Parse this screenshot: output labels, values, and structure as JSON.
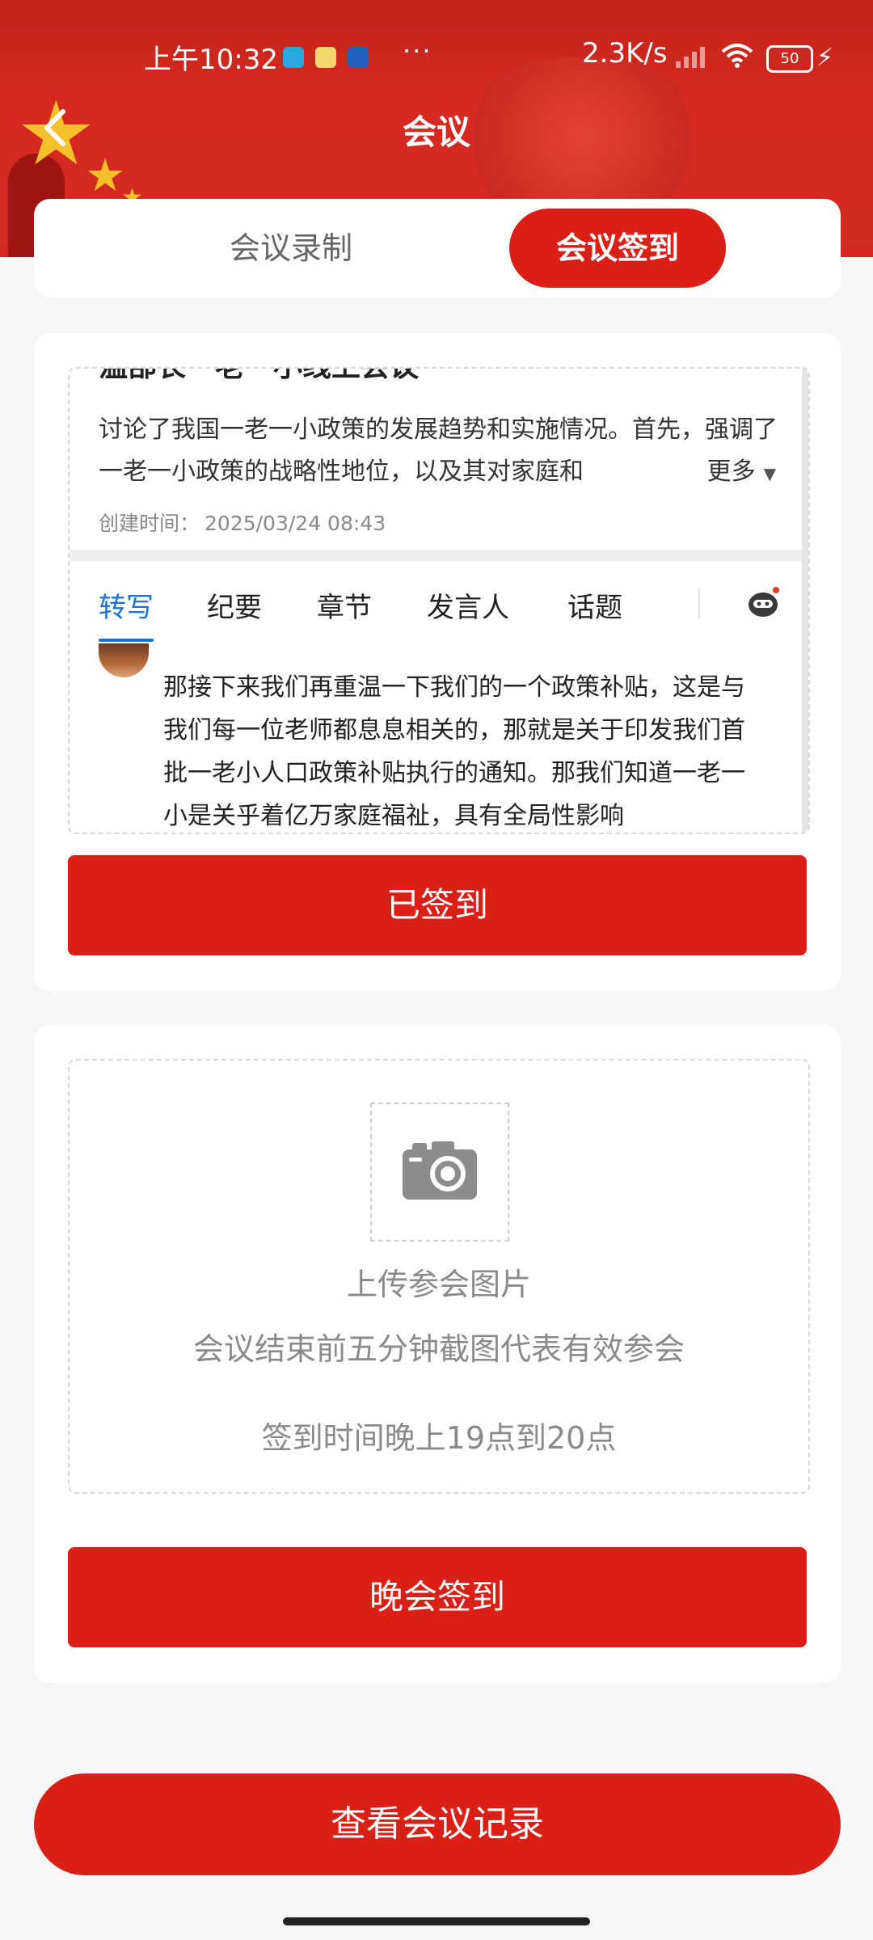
{
  "status_bar": {
    "time": "上午10:32",
    "more_dots": "···",
    "net_speed": "2.3K/s",
    "battery": "50",
    "charging_icon": "bolt-icon"
  },
  "header": {
    "title": "会议",
    "back_icon": "chevron-left-icon"
  },
  "tabs": [
    {
      "label": "会议录制",
      "active": false
    },
    {
      "label": "会议签到",
      "active": true
    }
  ],
  "meeting_preview": {
    "title": "温部长一老一小线上会议",
    "summary": "讨论了我国一老一小政策的发展趋势和实施情况。首先，强调了一老一小政策的战略性地位，以及其对家庭和",
    "more_label": "更多",
    "created_label": "创建时间：",
    "created_time": "2025/03/24 08:43",
    "subtabs": [
      "转写",
      "纪要",
      "章节",
      "发言人",
      "话题"
    ],
    "active_subtab": "转写",
    "transcript": "那接下来我们再重温一下我们的一个政策补贴，这是与我们每一位老师都息息相关的，那就是关于印发我们首批一老小人口政策补贴执行的通知。那我们知道一老一小是关乎着亿万家庭福祉，具有全局性影响"
  },
  "signed_button": "已签到",
  "upload": {
    "icon": "camera-icon",
    "title": "上传参会图片",
    "hint": "会议结束前五分钟截图代表有效参会",
    "time_rule": "签到时间晚上19点到20点"
  },
  "evening_button": "晚会签到",
  "records_button": "查看会议记录",
  "colors": {
    "brand_red": "#da1f16",
    "link_blue": "#1a73d9"
  }
}
